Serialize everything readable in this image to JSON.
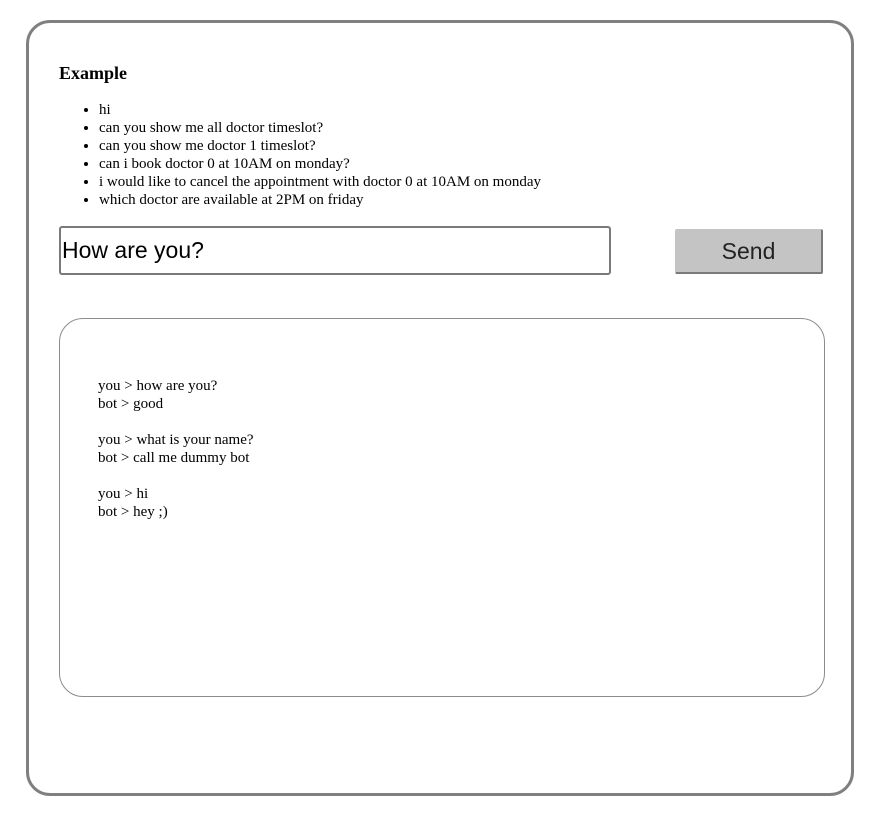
{
  "examples": {
    "title": "Example",
    "items": [
      "hi",
      "can you show me all doctor timeslot?",
      "can you show me doctor 1 timeslot?",
      "can i book doctor 0 at 10AM on monday?",
      "i would like to cancel the appointment with doctor 0 at 10AM on monday",
      "which doctor are available at 2PM on friday"
    ]
  },
  "input": {
    "value": "How are you?",
    "placeholder": ""
  },
  "send_button": {
    "label": "Send"
  },
  "chat_log": {
    "messages": [
      {
        "user": "you > how are you?",
        "bot": "bot > good"
      },
      {
        "user": "you > what is your name?",
        "bot": "bot > call me dummy bot"
      },
      {
        "user": "you > hi",
        "bot": "bot > hey ;)"
      }
    ]
  },
  "colors": {
    "border": "#808080",
    "button_bg": "#c4c4c4"
  }
}
